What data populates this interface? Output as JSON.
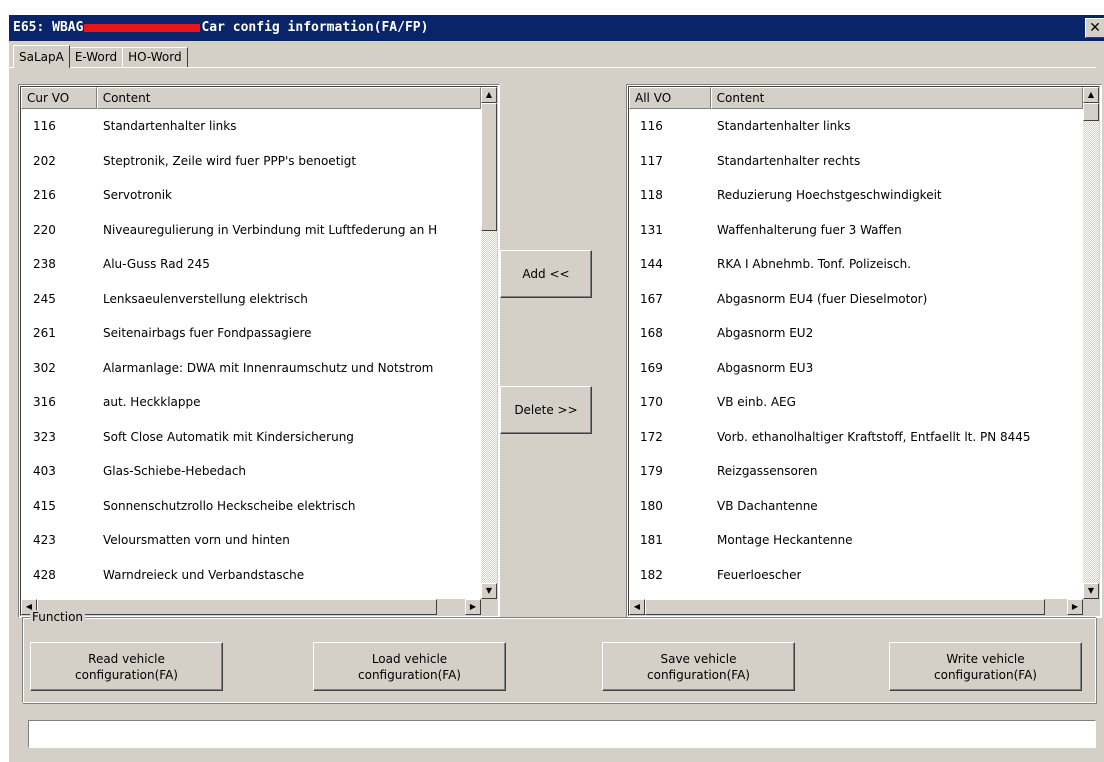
{
  "window": {
    "title_prefix": "E65: WBAG",
    "title_suffix": "Car config information(FA/FP)",
    "close_glyph": "✕"
  },
  "tabs": [
    {
      "label": "SaLapA",
      "active": true
    },
    {
      "label": "E-Word",
      "active": false
    },
    {
      "label": "HO-Word",
      "active": false
    }
  ],
  "left_list": {
    "columns": [
      "Cur VO",
      "Content"
    ],
    "rows": [
      [
        "116",
        "Standartenhalter links"
      ],
      [
        "202",
        "Steptronik, Zeile wird fuer PPP's benoetigt"
      ],
      [
        "216",
        "Servotronik"
      ],
      [
        "220",
        "Niveauregulierung in Verbindung mit Luftfederung an H"
      ],
      [
        "238",
        "Alu-Guss Rad 245"
      ],
      [
        "245",
        "Lenksaeulenverstellung elektrisch"
      ],
      [
        "261",
        "Seitenairbags fuer Fondpassagiere"
      ],
      [
        "302",
        "Alarmanlage: DWA mit Innenraumschutz und Notstrom"
      ],
      [
        "316",
        "aut. Heckklappe"
      ],
      [
        "323",
        "Soft Close Automatik mit Kindersicherung"
      ],
      [
        "403",
        "Glas-Schiebe-Hebedach"
      ],
      [
        "415",
        "Sonnenschutzrollo Heckscheibe elektrisch"
      ],
      [
        "423",
        "Veloursmatten vorn und hinten"
      ],
      [
        "428",
        "Warndreieck und Verbandstasche"
      ]
    ]
  },
  "right_list": {
    "columns": [
      "All VO",
      "Content"
    ],
    "rows": [
      [
        "116",
        "Standartenhalter links"
      ],
      [
        "117",
        "Standartenhalter rechts"
      ],
      [
        "118",
        "Reduzierung Hoechstgeschwindigkeit"
      ],
      [
        "131",
        "Waffenhalterung fuer 3 Waffen"
      ],
      [
        "144",
        "RKA I Abnehmb. Tonf. Polizeisch."
      ],
      [
        "167",
        "Abgasnorm EU4 (fuer Dieselmotor)"
      ],
      [
        "168",
        "Abgasnorm EU2"
      ],
      [
        "169",
        "Abgasnorm EU3"
      ],
      [
        "170",
        "VB einb. AEG"
      ],
      [
        "172",
        "Vorb. ethanolhaltiger Kraftstoff, Entfaellt lt. PN 8445"
      ],
      [
        "179",
        "Reizgassensoren"
      ],
      [
        "180",
        "VB Dachantenne"
      ],
      [
        "181",
        "Montage Heckantenne"
      ],
      [
        "182",
        "Feuerloescher"
      ]
    ]
  },
  "actions": {
    "add_label": "Add <<",
    "delete_label": "Delete >>"
  },
  "function_group": {
    "label": "Function",
    "buttons": [
      {
        "line1": "Read vehicle",
        "line2": "configuration(FA)"
      },
      {
        "line1": "Load vehicle",
        "line2": "configuration(FA)"
      },
      {
        "line1": "Save vehicle",
        "line2": "configuration(FA)"
      },
      {
        "line1": "Write vehicle",
        "line2": "configuration(FA)"
      }
    ]
  },
  "scroll": {
    "up": "▲",
    "down": "▼",
    "left": "◀",
    "right": "▶"
  },
  "colors": {
    "title_bar": "#0a246a",
    "window_face": "#d4d0c8",
    "redaction": "#e8141a"
  }
}
